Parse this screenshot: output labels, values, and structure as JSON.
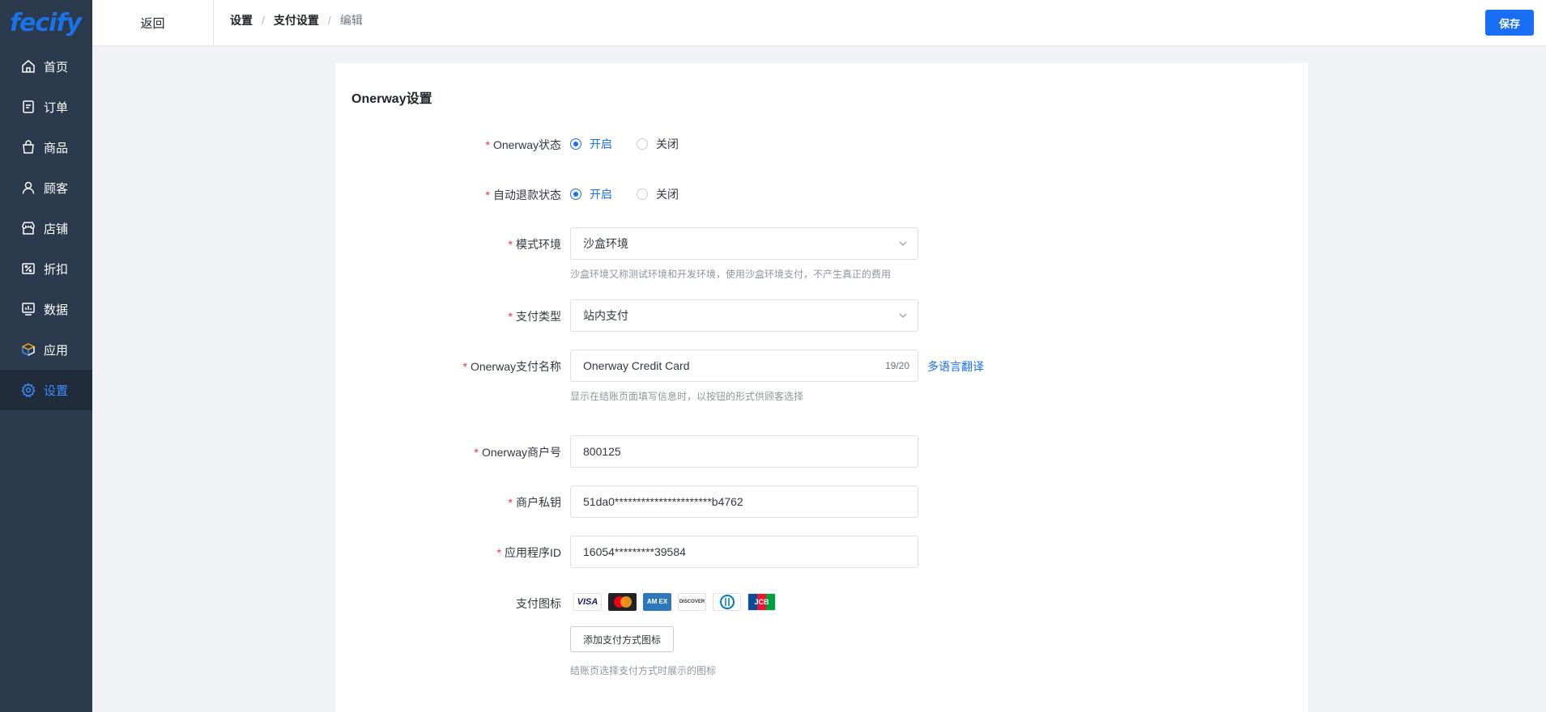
{
  "brand": {
    "logo_text": "fecify"
  },
  "sidebar": {
    "items": [
      {
        "label": "首页",
        "icon": "home-icon"
      },
      {
        "label": "订单",
        "icon": "order-icon"
      },
      {
        "label": "商品",
        "icon": "bag-icon"
      },
      {
        "label": "顾客",
        "icon": "user-icon"
      },
      {
        "label": "店铺",
        "icon": "store-icon"
      },
      {
        "label": "折扣",
        "icon": "discount-icon"
      },
      {
        "label": "数据",
        "icon": "chart-icon"
      },
      {
        "label": "应用",
        "icon": "app-icon"
      },
      {
        "label": "设置",
        "icon": "gear-icon",
        "active": true
      }
    ]
  },
  "topbar": {
    "back_label": "返回",
    "breadcrumb": [
      "设置",
      "支付设置",
      "编辑"
    ],
    "save_label": "保存"
  },
  "form": {
    "title": "Onerway设置",
    "status": {
      "label": "Onerway状态",
      "options": [
        "开启",
        "关闭"
      ],
      "selected": "开启"
    },
    "auto_refund": {
      "label": "自动退款状态",
      "options": [
        "开启",
        "关闭"
      ],
      "selected": "开启"
    },
    "mode": {
      "label": "模式环境",
      "value": "沙盒环境",
      "hint": "沙盒环境又称测试环境和开发环境，使用沙盒环境支付，不产生真正的费用"
    },
    "pay_type": {
      "label": "支付类型",
      "value": "站内支付"
    },
    "pay_name": {
      "label": "Onerway支付名称",
      "value": "Onerway Credit Card",
      "counter": "19/20",
      "link": "多语言翻译",
      "hint": "显示在结账页面填写信息时，以按钮的形式供顾客选择"
    },
    "merchant_no": {
      "label": "Onerway商户号",
      "value": "800125"
    },
    "merchant_key": {
      "label": "商户私钥",
      "value": "51da0**********************b4762"
    },
    "app_id": {
      "label": "应用程序ID",
      "value": "16054*********39584"
    },
    "pay_icons": {
      "label": "支付图标",
      "icons": [
        "visa-icon",
        "mastercard-icon",
        "amex-icon",
        "discover-icon",
        "diners-icon",
        "jcb-icon"
      ],
      "icon_texts": {
        "visa": "VISA",
        "amex": "AM EX",
        "discover": "DISCOVER",
        "jcb": "JCB"
      },
      "add_label": "添加支付方式图标",
      "hint": "结账页选择支付方式时展示的图标"
    }
  },
  "colors": {
    "primary": "#1a6ef5",
    "sidebar_bg": "#2b3a4c",
    "required": "#f0313f"
  }
}
